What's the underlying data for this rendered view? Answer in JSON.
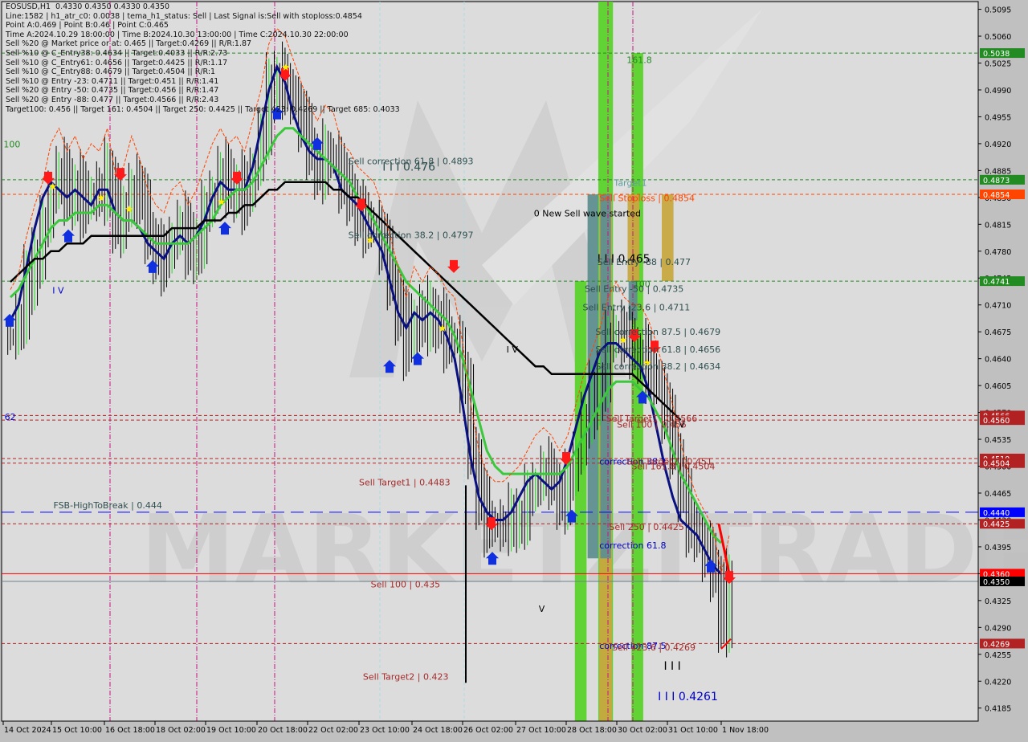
{
  "window": {
    "symbol": "EOSUSD,H1",
    "ohlc": "0.4330 0.4350 0.4330 0.4350"
  },
  "info_lines": [
    "EOSUSD,H1  0.4330 0.4350 0.4330 0.4350",
    "Line:1582 | h1_atr_c0: 0.0038 | tema_h1_status: Sell | Last Signal is:Sell with stoploss:0.4854",
    "Point A:0.469 | Point B:0.46 | Point C:0.465",
    "Time A:2024.10.29 18:00:00 | Time B:2024.10.30 13:00:00 | Time C:2024.10.30 22:00:00",
    "Sell %20 @ Market price or at: 0.465 || Target:0.4269 || R/R:1.87",
    "Sell %10 @ C_Entry38: 0.4634 || Target:0.4033 || R/R:2.73",
    "Sell %10 @ C_Entry61: 0.4656 || Target:0.4425 || R/R:1.17",
    "Sell %10 @ C_Entry88: 0.4679 || Target:0.4504 || R/R:1",
    "Sell %10 @ Entry -23: 0.4711 || Target:0.451 || R/R:1.41",
    "Sell %20 @ Entry -50: 0.4735 || Target:0.456 || R/R:1.47",
    "Sell %20 @ Entry -88: 0.477 || Target:0.4566 || R/R:2.43",
    "Target100: 0.456 || Target 161: 0.4504 || Target 250: 0.4425 || Target 423: 0.4269 || Target 685: 0.4033"
  ],
  "colors": {
    "background": "#dcdcdc",
    "axis_panel": "#c0c0c0",
    "bull_zone": "#5ad22a",
    "bear_zone": "#c8a840",
    "teal_zone": "#5f8f8f",
    "tema_line": "#0a1080",
    "ma_green": "#3cc83c",
    "ma_black": "#000000",
    "stop_orange": "#ff4500",
    "target_red": "#a52a2a",
    "entry_green": "#228b22",
    "fsb_blue": "#0000ff",
    "current_price": "#000000",
    "resistance_red": "#ff0000"
  },
  "chart_data": {
    "type": "candlestick",
    "title": "EOSUSD,H1",
    "ylim": [
      0.4168,
      0.5105
    ],
    "y_ticks": [
      0.5095,
      0.506,
      0.5025,
      0.499,
      0.4955,
      0.492,
      0.4885,
      0.485,
      0.4815,
      0.478,
      0.4745,
      0.471,
      0.4675,
      0.464,
      0.4605,
      0.457,
      0.4535,
      0.45,
      0.4465,
      0.443,
      0.4395,
      0.436,
      0.4325,
      0.429,
      0.4255,
      0.422,
      0.4185
    ],
    "x_ticks": [
      "14 Oct 2024",
      "15 Oct 10:00",
      "16 Oct 18:00",
      "18 Oct 02:00",
      "19 Oct 10:00",
      "20 Oct 18:00",
      "22 Oct 02:00",
      "23 Oct 10:00",
      "24 Oct 18:00",
      "26 Oct 02:00",
      "27 Oct 10:00",
      "28 Oct 18:00",
      "30 Oct 02:00",
      "31 Oct 10:00",
      "1 Nov 18:00"
    ],
    "price_badges": [
      {
        "value": "0.5038",
        "color": "#228b22"
      },
      {
        "value": "0.4873",
        "color": "#228b22"
      },
      {
        "value": "0.4854",
        "color": "#ff4500"
      },
      {
        "value": "0.4741",
        "color": "#228b22"
      },
      {
        "value": "0.4566",
        "color": "#b22222"
      },
      {
        "value": "0.4560",
        "color": "#b22222"
      },
      {
        "value": "0.4510",
        "color": "#b22222"
      },
      {
        "value": "0.4504",
        "color": "#b22222"
      },
      {
        "value": "0.4440",
        "color": "#0000ff"
      },
      {
        "value": "0.4425",
        "color": "#b22222"
      },
      {
        "value": "0.4360",
        "color": "#ff0000"
      },
      {
        "value": "0.4350",
        "color": "#000000"
      },
      {
        "value": "0.4269",
        "color": "#b22222"
      }
    ],
    "horizontal_lines": [
      {
        "price": 0.5038,
        "style": "dash",
        "color": "#228b22"
      },
      {
        "price": 0.4873,
        "style": "dash",
        "color": "#228b22"
      },
      {
        "price": 0.4854,
        "style": "dash",
        "color": "#ff4500"
      },
      {
        "price": 0.4741,
        "style": "dash",
        "color": "#228b22"
      },
      {
        "price": 0.4566,
        "style": "dash",
        "color": "#b22222"
      },
      {
        "price": 0.456,
        "style": "dash",
        "color": "#b22222"
      },
      {
        "price": 0.451,
        "style": "dash",
        "color": "#b22222"
      },
      {
        "price": 0.4504,
        "style": "dash",
        "color": "#b22222"
      },
      {
        "price": 0.444,
        "style": "longdash",
        "color": "#0000ff"
      },
      {
        "price": 0.4425,
        "style": "dash",
        "color": "#b22222"
      },
      {
        "price": 0.436,
        "style": "solid",
        "color": "#ff0000"
      },
      {
        "price": 0.435,
        "style": "solid",
        "color": "#708090"
      },
      {
        "price": 0.4269,
        "style": "dash",
        "color": "#b22222"
      }
    ],
    "annotations": [
      {
        "text": "Sell correction 61.8 | 0.4893",
        "price": 0.4893,
        "x_frac": 0.355,
        "color": "#2f4f4f"
      },
      {
        "text": "I I I 0.476",
        "price": 0.4885,
        "x_frac": 0.39,
        "color": "#2f4f4f"
      },
      {
        "text": "Sell correction 38.2 | 0.4797",
        "price": 0.4797,
        "x_frac": 0.355,
        "color": "#2f4f4f"
      },
      {
        "text": "0 New Sell wave started",
        "price": 0.4825,
        "x_frac": 0.545,
        "color": "#000000"
      },
      {
        "text": "Target1",
        "price": 0.4865,
        "x_frac": 0.627,
        "color": "#5f9ea0"
      },
      {
        "text": "Sell Stoploss | 0.4854",
        "price": 0.4845,
        "x_frac": 0.612,
        "color": "#ff4500"
      },
      {
        "text": "161.8",
        "price": 0.5025,
        "x_frac": 0.64,
        "color": "#228b22"
      },
      {
        "text": "I I I 0.465",
        "price": 0.4765,
        "x_frac": 0.61,
        "color": "#000000"
      },
      {
        "text": "Sell Entry -88 | 0.477",
        "price": 0.4762,
        "x_frac": 0.61,
        "color": "#2f4f4f"
      },
      {
        "text": "100",
        "price": 0.4733,
        "x_frac": 0.647,
        "color": "#228b22"
      },
      {
        "text": "Sell Entry -50 | 0.4735",
        "price": 0.4727,
        "x_frac": 0.597,
        "color": "#2f4f4f"
      },
      {
        "text": "Sell Entry -23.6 | 0.4711",
        "price": 0.4703,
        "x_frac": 0.595,
        "color": "#2f4f4f"
      },
      {
        "text": "Sell correction 87.5 | 0.4679",
        "price": 0.4671,
        "x_frac": 0.608,
        "color": "#2f4f4f"
      },
      {
        "text": "Sell correction 61.8 | 0.4656",
        "price": 0.4648,
        "x_frac": 0.608,
        "color": "#2f4f4f"
      },
      {
        "text": "Sell correction 38.2 | 0.4634",
        "price": 0.4626,
        "x_frac": 0.608,
        "color": "#2f4f4f"
      },
      {
        "text": "Sell Target1 | 0.4566",
        "price": 0.4558,
        "x_frac": 0.619,
        "color": "#a52a2a"
      },
      {
        "text": "Sell 100 | 0.456",
        "price": 0.455,
        "x_frac": 0.63,
        "color": "#a52a2a"
      },
      {
        "text": "I V",
        "price": 0.455,
        "x_frac": 0.688,
        "color": "#000000"
      },
      {
        "text": "correction 38.2",
        "price": 0.4502,
        "x_frac": 0.612,
        "color": "#0000cd"
      },
      {
        "text": "Sell Target2 | 0.451",
        "price": 0.4502,
        "x_frac": 0.64,
        "color": "#a52a2a"
      },
      {
        "text": "Sell 161.8 | 0.4504",
        "price": 0.4496,
        "x_frac": 0.645,
        "color": "#a52a2a"
      },
      {
        "text": "Sell  250 | 0.4425",
        "price": 0.4417,
        "x_frac": 0.622,
        "color": "#a52a2a"
      },
      {
        "text": "correction 61.8",
        "price": 0.4393,
        "x_frac": 0.612,
        "color": "#0000cd"
      },
      {
        "text": "correction 87.5",
        "price": 0.4262,
        "x_frac": 0.612,
        "color": "#0000cd"
      },
      {
        "text": "Sell 423.6 | 0.4269",
        "price": 0.426,
        "x_frac": 0.625,
        "color": "#a52a2a"
      },
      {
        "text": "I I I",
        "price": 0.4235,
        "x_frac": 0.678,
        "color": "#000000"
      },
      {
        "text": "I I I 0.4261",
        "price": 0.4195,
        "x_frac": 0.672,
        "color": "#0000cd"
      },
      {
        "text": "Sell Target1 | 0.4483",
        "price": 0.4475,
        "x_frac": 0.366,
        "color": "#a52a2a"
      },
      {
        "text": "Sell 100 | 0.435",
        "price": 0.4342,
        "x_frac": 0.378,
        "color": "#a52a2a"
      },
      {
        "text": "Sell Target2 | 0.423",
        "price": 0.4222,
        "x_frac": 0.37,
        "color": "#a52a2a"
      },
      {
        "text": "FSB-HighToBreak | 0.444",
        "price": 0.4445,
        "x_frac": 0.053,
        "color": "#2f4f4f"
      },
      {
        "text": "I V",
        "price": 0.4648,
        "x_frac": 0.517,
        "color": "#000000"
      },
      {
        "text": "V",
        "price": 0.431,
        "x_frac": 0.55,
        "color": "#000000"
      },
      {
        "text": "I V",
        "price": 0.4725,
        "x_frac": 0.052,
        "color": "#0000cd"
      },
      {
        "text": "100",
        "price": 0.4915,
        "x_frac": 0.002,
        "color": "#228b22"
      },
      {
        "text": "62",
        "price": 0.456,
        "x_frac": 0.003,
        "color": "#0000cd"
      }
    ],
    "series": [
      {
        "name": "price_close",
        "values": [
          0.467,
          0.469,
          0.474,
          0.478,
          0.481,
          0.486,
          0.488,
          0.485,
          0.487,
          0.484,
          0.486,
          0.485,
          0.488,
          0.482,
          0.483,
          0.487,
          0.484,
          0.48,
          0.478,
          0.477,
          0.48,
          0.481,
          0.478,
          0.48,
          0.483,
          0.486,
          0.488,
          0.486,
          0.487,
          0.485,
          0.489,
          0.493,
          0.499,
          0.501,
          0.5,
          0.497,
          0.494,
          0.491,
          0.489,
          0.491,
          0.49,
          0.486,
          0.485,
          0.483,
          0.482,
          0.481,
          0.478,
          0.474,
          0.47,
          0.466,
          0.47,
          0.468,
          0.47,
          0.469,
          0.467,
          0.466,
          0.46,
          0.452,
          0.446,
          0.443,
          0.442,
          0.442,
          0.443,
          0.444,
          0.446,
          0.448,
          0.449,
          0.448,
          0.446,
          0.448,
          0.452,
          0.456,
          0.459,
          0.462,
          0.466,
          0.468,
          0.466,
          0.465,
          0.465,
          0.463,
          0.46,
          0.456,
          0.452,
          0.447,
          0.443,
          0.44,
          0.438,
          0.436,
          0.43,
          0.435
        ]
      },
      {
        "name": "tema",
        "values": [
          0.469,
          0.471,
          0.476,
          0.481,
          0.485,
          0.487,
          0.486,
          0.485,
          0.486,
          0.485,
          0.484,
          0.486,
          0.486,
          0.483,
          0.482,
          0.482,
          0.481,
          0.479,
          0.478,
          0.477,
          0.479,
          0.48,
          0.479,
          0.48,
          0.482,
          0.485,
          0.487,
          0.486,
          0.486,
          0.486,
          0.489,
          0.494,
          0.499,
          0.502,
          0.5,
          0.496,
          0.493,
          0.491,
          0.49,
          0.49,
          0.489,
          0.486,
          0.485,
          0.484,
          0.482,
          0.48,
          0.478,
          0.474,
          0.47,
          0.468,
          0.47,
          0.469,
          0.47,
          0.469,
          0.467,
          0.464,
          0.458,
          0.451,
          0.446,
          0.444,
          0.443,
          0.443,
          0.444,
          0.446,
          0.448,
          0.449,
          0.448,
          0.447,
          0.448,
          0.451,
          0.455,
          0.459,
          0.462,
          0.465,
          0.466,
          0.466,
          0.465,
          0.464,
          0.463,
          0.46,
          0.455,
          0.45,
          0.446,
          0.443,
          0.442,
          0.441,
          0.439,
          0.437,
          0.436
        ]
      },
      {
        "name": "ma_green",
        "values": [
          0.472,
          0.473,
          0.475,
          0.477,
          0.479,
          0.481,
          0.482,
          0.482,
          0.483,
          0.483,
          0.483,
          0.484,
          0.484,
          0.483,
          0.482,
          0.482,
          0.481,
          0.48,
          0.479,
          0.479,
          0.479,
          0.479,
          0.479,
          0.48,
          0.481,
          0.482,
          0.484,
          0.485,
          0.486,
          0.486,
          0.487,
          0.489,
          0.491,
          0.493,
          0.494,
          0.494,
          0.493,
          0.492,
          0.491,
          0.49,
          0.489,
          0.488,
          0.487,
          0.485,
          0.484,
          0.482,
          0.48,
          0.478,
          0.476,
          0.474,
          0.473,
          0.472,
          0.471,
          0.47,
          0.469,
          0.467,
          0.464,
          0.46,
          0.456,
          0.452,
          0.45,
          0.449,
          0.449,
          0.449,
          0.449,
          0.449,
          0.449,
          0.449,
          0.449,
          0.45,
          0.452,
          0.454,
          0.456,
          0.458,
          0.46,
          0.461,
          0.461,
          0.461,
          0.46,
          0.459,
          0.457,
          0.455,
          0.452,
          0.449,
          0.447,
          0.445,
          0.443,
          0.441,
          0.44
        ]
      },
      {
        "name": "ma_black",
        "values": [
          0.474,
          0.475,
          0.476,
          0.477,
          0.477,
          0.478,
          0.478,
          0.479,
          0.479,
          0.479,
          0.48,
          0.48,
          0.48,
          0.48,
          0.48,
          0.48,
          0.48,
          0.48,
          0.48,
          0.48,
          0.481,
          0.481,
          0.481,
          0.481,
          0.482,
          0.482,
          0.482,
          0.483,
          0.483,
          0.484,
          0.484,
          0.485,
          0.486,
          0.486,
          0.487,
          0.487,
          0.487,
          0.487,
          0.487,
          0.487,
          0.486,
          0.486,
          0.485,
          0.485,
          0.484,
          0.483,
          0.482,
          0.481,
          0.48,
          0.479,
          0.478,
          0.477,
          0.476,
          0.475,
          0.474,
          0.473,
          0.472,
          0.471,
          0.47,
          0.469,
          0.468,
          0.467,
          0.466,
          0.465,
          0.464,
          0.463,
          0.463,
          0.462,
          0.462,
          0.462,
          0.462,
          0.462,
          0.462,
          0.462,
          0.462,
          0.462,
          0.462,
          0.462,
          0.461,
          0.46,
          0.459,
          0.458,
          0.457,
          0.456
        ]
      }
    ],
    "zones": [
      {
        "type": "bull",
        "x_from": 0.587,
        "x_to": 0.599,
        "p_top": 0.4741,
        "p_bot": 0.4168
      },
      {
        "type": "teal",
        "x_from": 0.6,
        "x_to": 0.611,
        "p_top": 0.4854,
        "p_bot": 0.438
      },
      {
        "type": "bull",
        "x_from": 0.611,
        "x_to": 0.626,
        "p_top": 0.5105,
        "p_bot": 0.4168
      },
      {
        "type": "bear",
        "x_from": 0.612,
        "x_to": 0.625,
        "p_top": 0.4854,
        "p_bot": 0.4168
      },
      {
        "type": "teal",
        "x_from": 0.613,
        "x_to": 0.624,
        "p_top": 0.4854,
        "p_bot": 0.438
      },
      {
        "type": "bull",
        "x_from": 0.645,
        "x_to": 0.657,
        "p_top": 0.5038,
        "p_bot": 0.4168
      },
      {
        "type": "bear",
        "x_from": 0.641,
        "x_to": 0.653,
        "p_top": 0.4854,
        "p_bot": 0.4741
      },
      {
        "type": "teal",
        "x_from": 0.642,
        "x_to": 0.651,
        "p_top": 0.4741,
        "p_bot": 0.469
      },
      {
        "type": "bear",
        "x_from": 0.676,
        "x_to": 0.688,
        "p_top": 0.4854,
        "p_bot": 0.4741
      }
    ]
  }
}
